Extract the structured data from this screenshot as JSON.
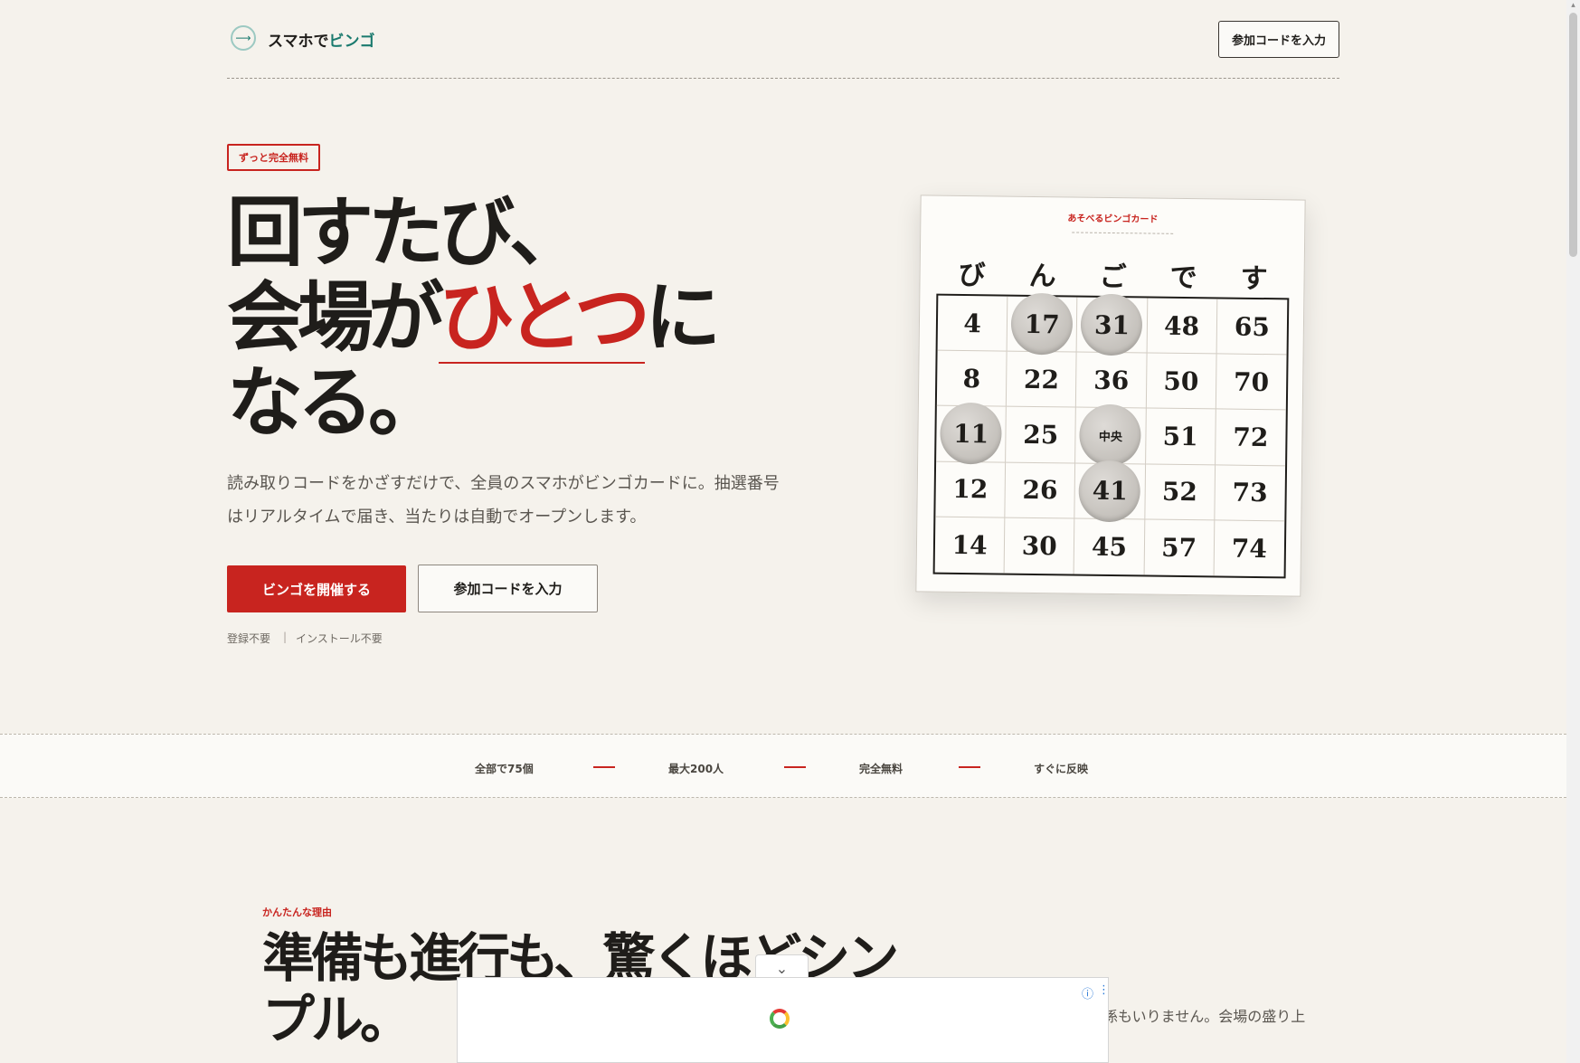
{
  "header": {
    "logo_text": "スマホで",
    "logo_accent": "ビンゴ",
    "join_button": "参加コードを入力"
  },
  "hero": {
    "badge": "ずっと完全無料",
    "title_line1": "回すたび、",
    "title_line2_prefix": "会場が",
    "title_line2_accent": "ひとつ",
    "title_line2_suffix": "に",
    "title_line3": "なる。",
    "description": "読み取りコードをかざすだけで、全員のスマホがビンゴカードに。抽選番号はリアルタイムで届き、当たりは自動でオープンします。",
    "primary_button": "ビンゴを開催する",
    "secondary_button": "参加コードを入力",
    "note_left": "登録不要",
    "note_sep": "|",
    "note_right": "インストール不要"
  },
  "card": {
    "title": "あそべるビンゴカード",
    "headers": [
      "び",
      "ん",
      "ご",
      "で",
      "す"
    ],
    "rows": [
      [
        {
          "v": "4",
          "m": false
        },
        {
          "v": "17",
          "m": true
        },
        {
          "v": "31",
          "m": true
        },
        {
          "v": "48",
          "m": false
        },
        {
          "v": "65",
          "m": false
        }
      ],
      [
        {
          "v": "8",
          "m": false
        },
        {
          "v": "22",
          "m": false
        },
        {
          "v": "36",
          "m": false
        },
        {
          "v": "50",
          "m": false
        },
        {
          "v": "70",
          "m": false
        }
      ],
      [
        {
          "v": "11",
          "m": true
        },
        {
          "v": "25",
          "m": false
        },
        {
          "v": "中央",
          "m": true,
          "c": true
        },
        {
          "v": "51",
          "m": false
        },
        {
          "v": "72",
          "m": false
        }
      ],
      [
        {
          "v": "12",
          "m": false
        },
        {
          "v": "26",
          "m": false
        },
        {
          "v": "41",
          "m": true
        },
        {
          "v": "52",
          "m": false
        },
        {
          "v": "73",
          "m": false
        }
      ],
      [
        {
          "v": "14",
          "m": false
        },
        {
          "v": "30",
          "m": false
        },
        {
          "v": "45",
          "m": false
        },
        {
          "v": "57",
          "m": false
        },
        {
          "v": "74",
          "m": false
        }
      ]
    ]
  },
  "stats": [
    "全部で75個",
    "最大200人",
    "完全無料",
    "すぐに反映"
  ],
  "section": {
    "label": "かんたんな理由",
    "title_line1": "準備も進行も、驚くほどシン",
    "title_line2": "プル。",
    "desc_fragment": "係もいりません。会場の盛り上"
  },
  "ad": {
    "collapse_icon": "chevron-down",
    "info_icon": "ⓘ",
    "more_icon": "⋮"
  },
  "colors": {
    "accent": "#c8241f",
    "brand": "#1a7a6e",
    "background": "#f5f2ec"
  }
}
